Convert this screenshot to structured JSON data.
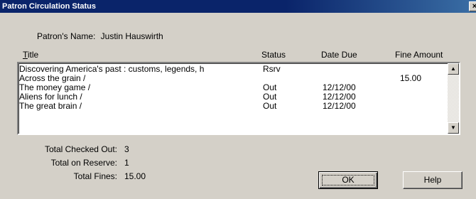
{
  "window": {
    "title": "Patron Circulation Status",
    "close_glyph": "×"
  },
  "patron": {
    "label": "Patron's Name:",
    "name": "Justin Hauswirth"
  },
  "columns": {
    "title_accel": "T",
    "title_rest": "itle",
    "status": "Status",
    "date_due": "Date Due",
    "fine_amount": "Fine Amount"
  },
  "items": [
    {
      "title": "Discovering America's past : customs, legends, h",
      "status": "Rsrv",
      "date_due": "",
      "fine": ""
    },
    {
      "title": "Across the grain /",
      "status": "",
      "date_due": "",
      "fine": "15.00"
    },
    {
      "title": "The money game /",
      "status": "Out",
      "date_due": "12/12/00",
      "fine": ""
    },
    {
      "title": "Aliens for lunch /",
      "status": "Out",
      "date_due": "12/12/00",
      "fine": ""
    },
    {
      "title": "The great brain /",
      "status": "Out",
      "date_due": "12/12/00",
      "fine": ""
    }
  ],
  "totals": {
    "checked_out_label": "Total Checked Out:",
    "checked_out": "3",
    "reserve_label": "Total on Reserve:",
    "reserve": "1",
    "fines_label": "Total Fines:",
    "fines": "15.00"
  },
  "buttons": {
    "ok": "OK",
    "help": "Help"
  },
  "scroll": {
    "up_glyph": "▲",
    "down_glyph": "▼"
  },
  "colors": {
    "titlebar": "#0a246a",
    "face": "#d4d0c8"
  }
}
